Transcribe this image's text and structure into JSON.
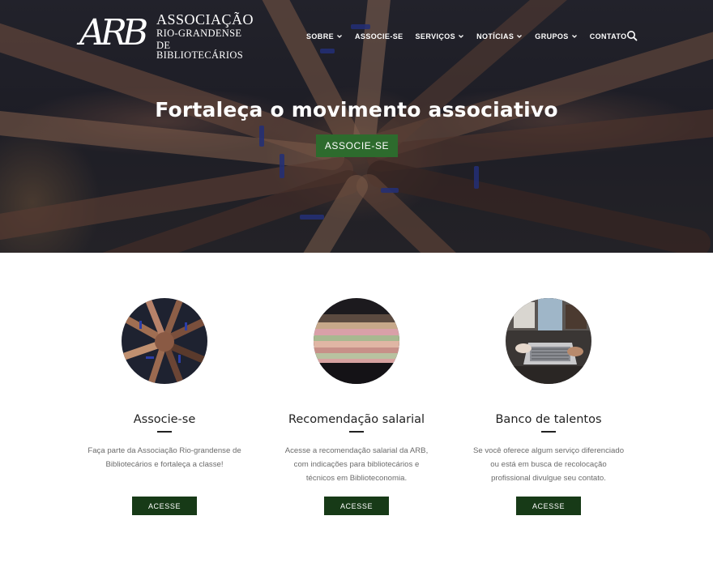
{
  "header": {
    "logo": {
      "monogram": "ARB",
      "line1": "ASSOCIAÇÃO",
      "line2": "RIO-GRANDENSE",
      "line3": "DE BIBLIOTECÁRIOS"
    },
    "nav": [
      {
        "label": "SOBRE",
        "has_dropdown": true
      },
      {
        "label": "ASSOCIE-SE",
        "has_dropdown": false
      },
      {
        "label": "SERVIÇOS",
        "has_dropdown": true
      },
      {
        "label": "NOTÍCIAS",
        "has_dropdown": true
      },
      {
        "label": "GRUPOS",
        "has_dropdown": true
      },
      {
        "label": "CONTATO",
        "has_dropdown": false
      }
    ],
    "search_icon": "search-icon"
  },
  "hero": {
    "title": "Fortaleça o movimento associativo",
    "button_label": "ASSOCIE-SE"
  },
  "cards": [
    {
      "title": "Associe-se",
      "description_lines": [
        "Faça parte da Associação Rio-grandense de",
        "Bibliotecários e fortaleça a classe!"
      ],
      "button_label": "ACESSE",
      "image": "hands-together-photo"
    },
    {
      "title": "Recomendação salarial",
      "description_lines": [
        "Acesse a recomendação salarial da ARB,",
        "com indicações para bibliotecários e",
        "técnicos em Biblioteconomia."
      ],
      "button_label": "ACESSE",
      "image": "money-stack-photo"
    },
    {
      "title": "Banco de talentos",
      "description_lines": [
        "Se você oferece algum serviço diferenciado",
        "ou está em busca de recolocação",
        "profissional divulgue seu contato."
      ],
      "button_label": "ACESSE",
      "image": "laptop-meeting-photo"
    }
  ],
  "colors": {
    "hero_button": "#2d6b2d",
    "card_button": "#173a17",
    "title_text": "#222222",
    "body_text": "#6b6b6b"
  }
}
